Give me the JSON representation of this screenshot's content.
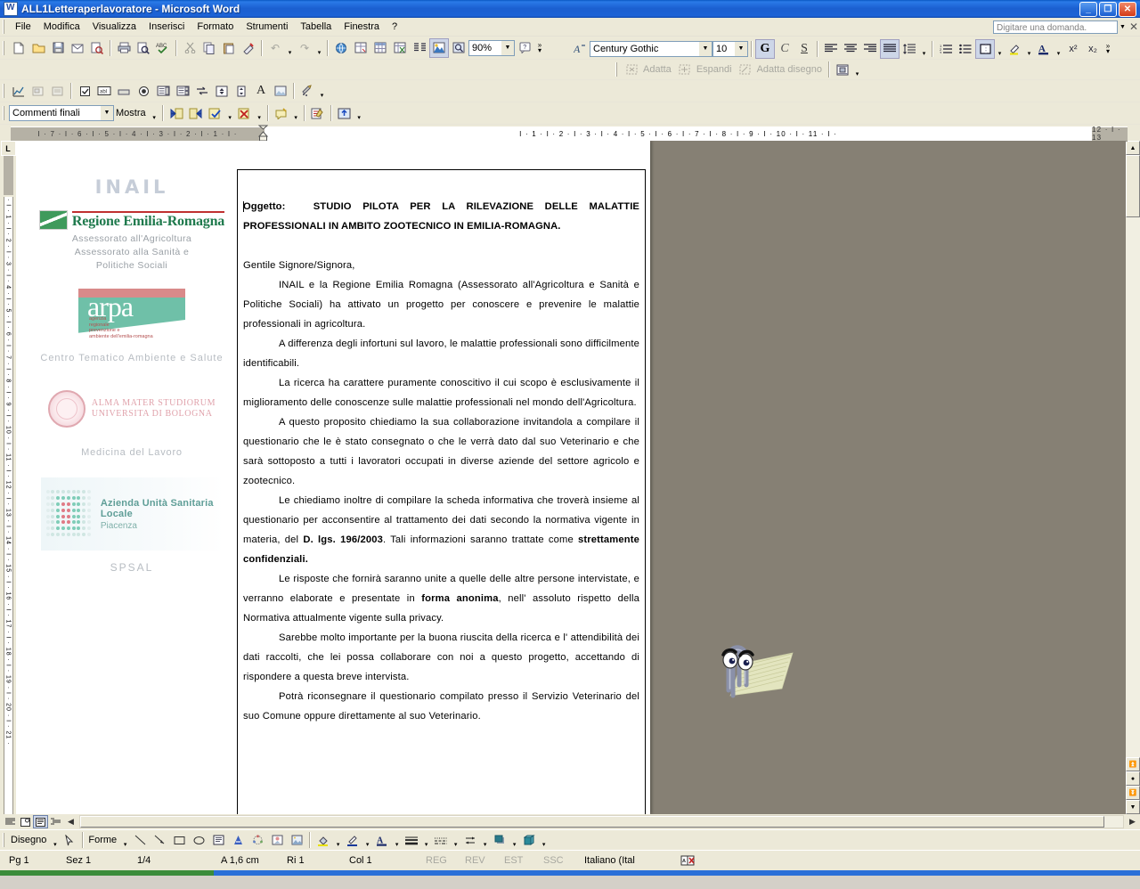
{
  "window": {
    "title": "ALL1Letteraperlavoratore - Microsoft Word",
    "app_icon": "word-document-icon",
    "minimize": "_",
    "maximize": "❐",
    "close": "✕"
  },
  "menu": {
    "items": [
      {
        "label": "File"
      },
      {
        "label": "Modifica"
      },
      {
        "label": "Visualizza"
      },
      {
        "label": "Inserisci"
      },
      {
        "label": "Formato"
      },
      {
        "label": "Strumenti"
      },
      {
        "label": "Tabella"
      },
      {
        "label": "Finestra"
      },
      {
        "label": "?"
      }
    ],
    "ask_question_placeholder": "Digitare una domanda.",
    "ask_question_value": "",
    "close_doc": "✕"
  },
  "toolbar_standard": {
    "buttons": [
      {
        "name": "new-document-icon",
        "glyph": "🗋"
      },
      {
        "name": "open-folder-icon",
        "glyph": "📂"
      },
      {
        "name": "save-icon",
        "glyph": "💾"
      },
      {
        "name": "email-icon",
        "glyph": "✉"
      },
      {
        "name": "search-file-icon",
        "glyph": "🔍"
      },
      {
        "name": "print-icon",
        "glyph": "🖨"
      },
      {
        "name": "print-preview-icon",
        "glyph": "🔎"
      },
      {
        "name": "spellcheck-icon",
        "glyph": "ABC"
      },
      {
        "name": "cut-icon",
        "glyph": "✂"
      },
      {
        "name": "copy-icon",
        "glyph": "⧉"
      },
      {
        "name": "paste-icon",
        "glyph": "📋"
      },
      {
        "name": "format-painter-icon",
        "glyph": "🖌"
      },
      {
        "name": "undo-icon",
        "glyph": "↩"
      },
      {
        "name": "redo-icon",
        "glyph": "↪"
      },
      {
        "name": "hyperlink-icon",
        "glyph": "🌐"
      },
      {
        "name": "tables-and-borders-icon",
        "glyph": "⊞"
      },
      {
        "name": "insert-table-icon",
        "glyph": "▦"
      },
      {
        "name": "insert-excel-sheet-icon",
        "glyph": "▧"
      },
      {
        "name": "columns-icon",
        "glyph": "☰"
      },
      {
        "name": "drawing-icon",
        "glyph": "◩"
      },
      {
        "name": "document-map-icon",
        "glyph": "🗺"
      }
    ],
    "zoom_value": "90%",
    "help_icon": "❓"
  },
  "toolbar_formatting": {
    "style_icon": "styles-and-formatting-icon",
    "font_name": "Century Gothic",
    "font_size": "10",
    "bold": "G",
    "italic": "C",
    "underline": "S",
    "align_left_icon": "align-left-icon",
    "align_center_icon": "align-center-icon",
    "align_right_icon": "align-right-icon",
    "align_justify_icon": "align-justify-icon",
    "line_spacing_icon": "line-spacing-icon",
    "numbered_list_icon": "numbered-list-icon",
    "bullet_list_icon": "bullet-list-icon",
    "borders_icon": "borders-icon",
    "highlight_icon": "highlight-color-icon",
    "font_color_icon": "font-color-icon",
    "superscript": "x²",
    "subscript": "x₂"
  },
  "toolbar_drawing_canvas": {
    "fit_label": "Adatta",
    "expand_label": "Espandi",
    "scale_label": "Adatta disegno",
    "text_wrap_icon": "text-wrapping-icon"
  },
  "toolbar_reviewing": {
    "display_mode": "Commenti finali",
    "show_label": "Mostra",
    "previous_icon": "previous-change-icon",
    "next_icon": "next-change-icon",
    "accept_icon": "accept-change-icon",
    "reject_icon": "reject-change-icon",
    "new_comment_icon": "new-comment-icon",
    "track_changes_icon": "track-changes-icon",
    "reviewing_pane_icon": "reviewing-pane-icon"
  },
  "ruler": {
    "left_marks": [
      "7",
      "6",
      "5",
      "4",
      "3",
      "2",
      "1"
    ],
    "right_marks": [
      "1",
      "2",
      "3",
      "4",
      "5",
      "6",
      "7",
      "8",
      "9",
      "10",
      "11",
      "12",
      "13"
    ],
    "vertical_marks": [
      "1",
      "2",
      "3",
      "4",
      "5",
      "6",
      "7",
      "8",
      "9",
      "10",
      "11",
      "12",
      "13",
      "14",
      "15",
      "16",
      "17",
      "18",
      "19",
      "20",
      "21"
    ],
    "tab_stop_icon": "left-tab-stop-icon"
  },
  "document": {
    "logos": {
      "inail": "INAIL",
      "regione": "Regione Emilia-Romagna",
      "regione_sub": [
        "Assessorato all'Agricoltura",
        "Assessorato alla Sanità e",
        "Politiche Sociali"
      ],
      "arpa_name": "arpa",
      "arpa_sub": [
        "agenzia",
        "regionale",
        "prevenzione e",
        "ambiente dell'emilia-romagna"
      ],
      "arpa_caption": "Centro Tematico Ambiente e Salute",
      "unibo_line1": "ALMA MATER STUDIORUM",
      "unibo_line2": "UNIVERSITA DI BOLOGNA",
      "unibo_caption": "Medicina del Lavoro",
      "ausl_line1": "Azienda Unità Sanitaria Locale",
      "ausl_line2": "Piacenza",
      "ausl_caption": "SPSAL"
    },
    "heading_label": "Oggetto:",
    "heading_line1": "STUDIO PILOTA PER LA RILEVAZIONE DELLE MALATTIE",
    "heading_line2": "PROFESSIONALI IN AMBITO ZOOTECNICO IN EMILIA-ROMAGNA.",
    "salutation": "Gentile Signore/Signora,",
    "paragraphs": [
      "INAIL e la Regione Emilia Romagna (Assessorato all'Agricoltura e Sanità e Politiche Sociali) ha attivato un progetto per conoscere e prevenire le malattie professionali in agricoltura.",
      "A differenza degli infortuni sul lavoro, le malattie professionali sono difficilmente identificabili.",
      "La ricerca ha carattere puramente conoscitivo il cui scopo è esclusivamente il miglioramento delle conoscenze sulle malattie professionali nel mondo dell'Agricoltura.",
      "A questo proposito chiediamo la sua collaborazione invitandola a compilare il questionario che le è stato consegnato o che le verrà dato dal suo Veterinario e che sarà sottoposto a tutti i lavoratori occupati in diverse aziende del settore agricolo e zootecnico."
    ],
    "para_privacy_a": "Le chiediamo inoltre di compilare la scheda informativa che troverà insieme al questionario per acconsentire al trattamento dei dati secondo la  normativa vigente in materia, del ",
    "para_privacy_bold1": "D. lgs. 196/2003",
    "para_privacy_b": ". Tali informazioni saranno trattate come ",
    "para_privacy_bold2": "strettamente confidenziali.",
    "para_anon_a": "Le risposte che fornirà saranno unite a quelle delle altre persone intervistate, e verranno elaborate e presentate in ",
    "para_anon_bold": "forma anonima",
    "para_anon_b": ", nell' assoluto rispetto della Normativa attualmente vigente sulla privacy.",
    "paragraphs_tail": [
      "Sarebbe molto importante per  la buona riuscita della ricerca e l' attendibilità dei dati raccolti, che lei possa collaborare con noi a questo progetto, accettando di rispondere a questa breve intervista.",
      "Potrà riconsegnare il questionario compilato presso il Servizio Veterinario del suo Comune oppure direttamente al suo Veterinario."
    ]
  },
  "office_assistant": {
    "name": "clippy-office-assistant"
  },
  "view_buttons": [
    {
      "name": "normal-view-icon",
      "glyph": "☰"
    },
    {
      "name": "web-layout-view-icon",
      "glyph": "▣"
    },
    {
      "name": "print-layout-view-icon",
      "glyph": "▤"
    },
    {
      "name": "outline-view-icon",
      "glyph": "⊟"
    }
  ],
  "toolbar_drawing": {
    "draw_label": "Disegno",
    "select_icon": "select-objects-icon",
    "autoshapes_label": "Forme",
    "line_icon": "line-icon",
    "arrow_icon": "arrow-icon",
    "rectangle_icon": "rectangle-icon",
    "oval_icon": "oval-icon",
    "textbox_icon": "text-box-icon",
    "wordart_icon": "wordart-icon",
    "diagram_icon": "diagram-icon",
    "clipart_icon": "clip-art-icon",
    "picture_icon": "insert-picture-icon",
    "fill_color_icon": "fill-color-icon",
    "line_color_icon": "line-color-icon",
    "font_color_icon": "font-color-icon",
    "line_style_icon": "line-style-icon",
    "dash_style_icon": "dash-style-icon",
    "arrow_style_icon": "arrow-style-icon",
    "shadow_icon": "shadow-style-icon",
    "3d_icon": "3d-style-icon"
  },
  "status_bar": {
    "page": "Pg 1",
    "section": "Sez 1",
    "page_of": "1/4",
    "position": "A 1,6 cm",
    "line": "Ri 1",
    "column": "Col 1",
    "rec": "REG",
    "trk": "REV",
    "ext": "EST",
    "ovr": "SSC",
    "language": "Italiano (Ital",
    "spell_icon": "spelling-status-icon"
  },
  "colors": {
    "title_bar": "#1b5fd0",
    "toolbar_bg": "#ece9d8",
    "canvas_bg": "#868074",
    "accent_green": "#3f9a5c",
    "arpa_teal": "#6fc0a8",
    "unibo_pink": "#e0a2ab"
  }
}
